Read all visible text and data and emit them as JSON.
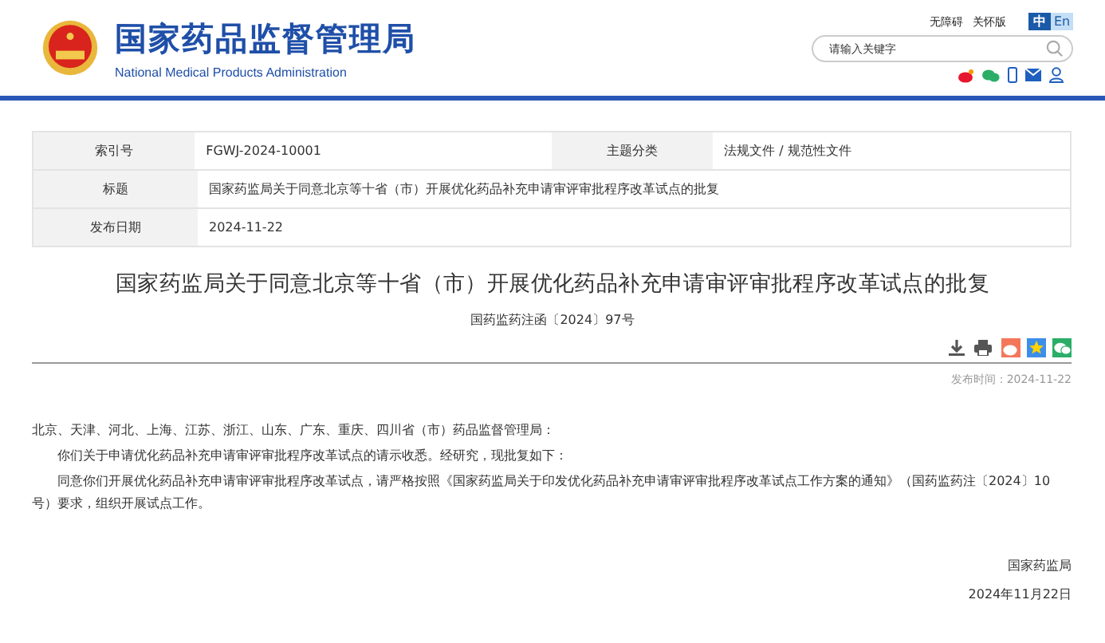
{
  "header": {
    "title": "国家药品监督管理局",
    "subtitle": "National Medical Products Administration",
    "links": [
      "无障碍",
      "关怀版"
    ],
    "languages": [
      {
        "label": "中",
        "selected": true
      },
      {
        "label": "En",
        "selected": false
      }
    ],
    "search": {
      "placeholder": "请输入关键字"
    }
  },
  "meta_table": {
    "rows": [
      {
        "cells": [
          {
            "label": "索引号",
            "value": "FGWJ-2024-10001"
          },
          {
            "label": "主题分类",
            "value": "法规文件 / 规范性文件"
          }
        ]
      },
      {
        "cells": [
          {
            "label": "标题",
            "value": "国家药监局关于同意北京等十省（市）开展优化药品补充申请审评审批程序改革试点的批复"
          }
        ]
      },
      {
        "cells": [
          {
            "label": "发布日期",
            "value": "2024-11-22"
          }
        ]
      }
    ]
  },
  "article": {
    "title": "国家药监局关于同意北京等十省（市）开展优化药品补充申请审评审批程序改革试点的批复",
    "doc_number": "国药监药注函〔2024〕97号",
    "published": "发布时间：2024-11-22",
    "paragraphs": [
      {
        "text": "北京、天津、河北、上海、江苏、浙江、山东、广东、重庆、四川省（市）药品监督管理局：",
        "indent": false
      },
      {
        "text": "你们关于申请优化药品补充申请审评审批程序改革试点的请示收悉。经研究，现批复如下：",
        "indent": true
      },
      {
        "text": "同意你们开展优化药品补充申请审评审批程序改革试点，请严格按照《国家药监局关于印发优化药品补充申请审评审批程序改革试点工作方案的通知》（国药监药注〔2024〕10号）要求，组织开展试点工作。",
        "indent": true
      }
    ],
    "signature": "国家药监局",
    "date": "2024年11月22日"
  }
}
